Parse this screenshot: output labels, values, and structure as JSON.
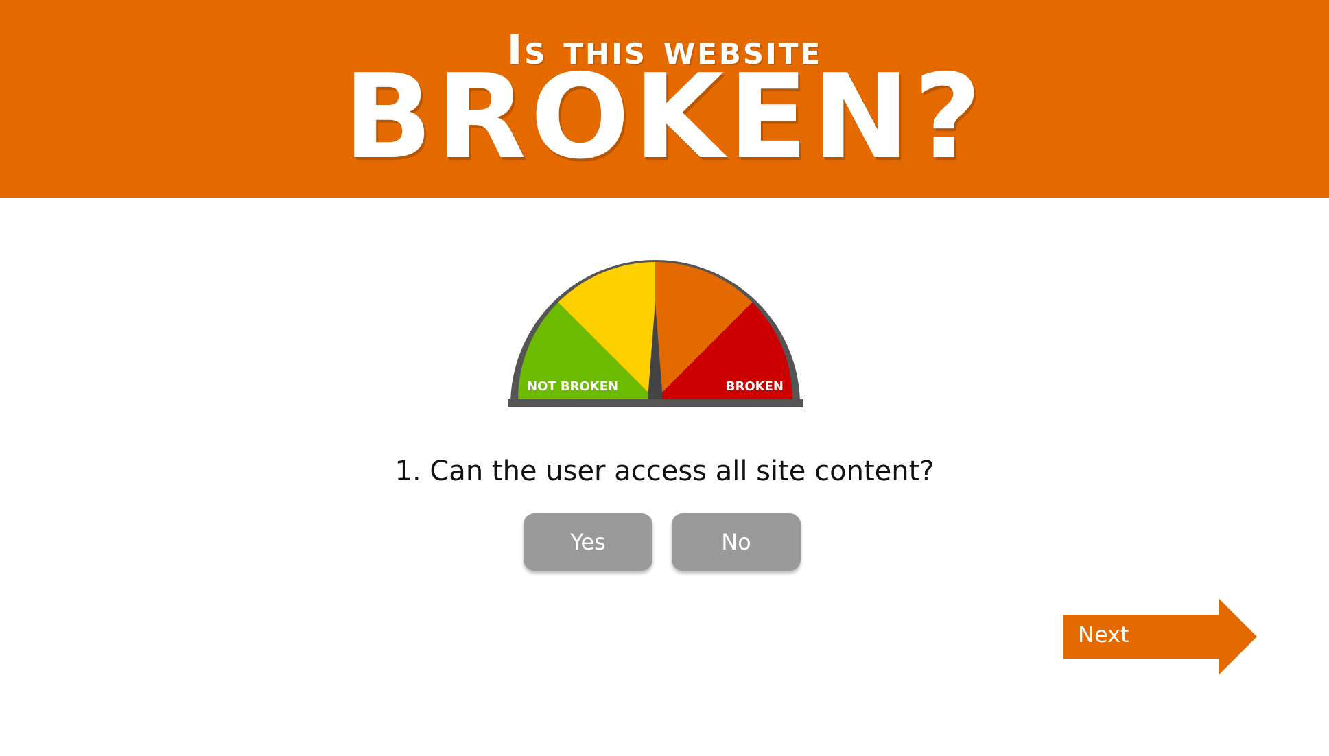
{
  "header": {
    "line1": "Is this website",
    "line2": "BROKEN?"
  },
  "gauge": {
    "left_label": "NOT BROKEN",
    "right_label": "BROKEN",
    "needle_position": 0.5
  },
  "question": {
    "text": "1. Can the user access all site content?"
  },
  "answers": {
    "yes_label": "Yes",
    "no_label": "No"
  },
  "navigation": {
    "next_label": "Next"
  },
  "colors": {
    "brand_orange": "#E46A00",
    "gauge_green": "#6DBB00",
    "gauge_yellow": "#FFD000",
    "gauge_orange": "#E46A00",
    "gauge_red": "#CC0000",
    "gauge_rim": "#555555",
    "button_gray": "#9A9A9A"
  },
  "icons": {
    "next": "arrow-right-icon",
    "gauge_needle": "gauge-needle-icon"
  }
}
